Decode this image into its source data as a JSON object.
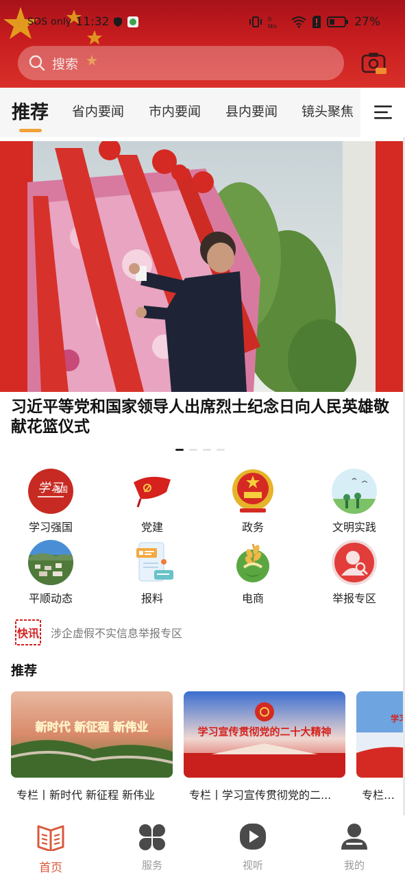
{
  "status_bar": {
    "carrier": "SOS only",
    "time": "11:32",
    "battery_percent": "27%"
  },
  "search": {
    "placeholder": "搜索"
  },
  "tabs": [
    {
      "label": "推荐",
      "active": true
    },
    {
      "label": "省内要闻"
    },
    {
      "label": "市内要闻"
    },
    {
      "label": "县内要闻"
    },
    {
      "label": "镜头聚焦"
    }
  ],
  "banner": {
    "headline": "习近平等党和国家领导人出席烈士纪念日向人民英雄敬献花篮仪式",
    "pages": 4,
    "active_page": 1
  },
  "quick_links": [
    {
      "label": "学习强国",
      "icon": "xuexi-qiangguo-icon"
    },
    {
      "label": "党建",
      "icon": "party-flag-icon"
    },
    {
      "label": "政务",
      "icon": "national-emblem-icon"
    },
    {
      "label": "文明实践",
      "icon": "civilization-practice-icon"
    },
    {
      "label": "平顺动态",
      "icon": "town-landscape-icon"
    },
    {
      "label": "报料",
      "icon": "report-document-icon"
    },
    {
      "label": "电商",
      "icon": "wheat-ecommerce-icon"
    },
    {
      "label": "举报专区",
      "icon": "report-person-icon"
    }
  ],
  "flash_news": {
    "badge": "快讯",
    "text": "涉企虚假不实信息举报专区"
  },
  "recommend": {
    "title": "推荐",
    "cards": [
      {
        "image_text": "新时代 新征程 新伟业",
        "label": "专栏丨新时代 新征程 新伟业"
      },
      {
        "image_text": "学习宣传贯彻党的二十大精神",
        "label": "专栏丨学习宣传贯彻党的二..."
      },
      {
        "image_text": "学习 在省部级",
        "label": "专栏丨学习"
      }
    ]
  },
  "bottom_nav": [
    {
      "label": "首页",
      "icon": "home-book-icon",
      "active": true
    },
    {
      "label": "服务",
      "icon": "services-grid-icon"
    },
    {
      "label": "视听",
      "icon": "video-play-icon"
    },
    {
      "label": "我的",
      "icon": "user-profile-icon"
    }
  ],
  "colors": {
    "brand_red": "#c81d1f",
    "tab_indicator": "#f0a13a",
    "nav_active": "#d9583a",
    "nav_inactive": "#9a9a9a"
  }
}
